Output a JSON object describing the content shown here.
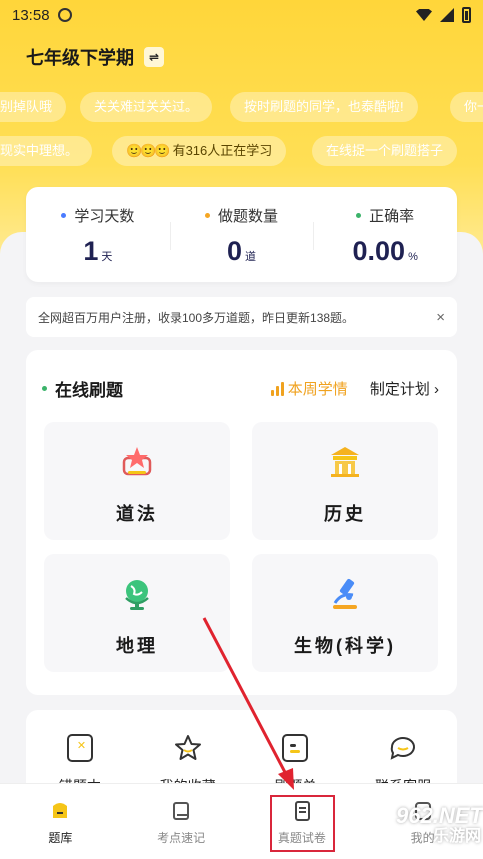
{
  "status": {
    "time": "13:58"
  },
  "header": {
    "grade": "七年级下学期",
    "switch_symbol": "⇌"
  },
  "ticker": {
    "row1": [
      "别掉队哦",
      "关关难过关关过。",
      "按时刷题的同学，也泰酷啦!",
      "你一"
    ],
    "row2": [
      "现实中理想。",
      "有316人正在学习",
      "在线捉一个刷题搭子"
    ]
  },
  "stats": [
    {
      "label": "学习天数",
      "value": "1",
      "unit": "天",
      "dot_color": "#4a7bff"
    },
    {
      "label": "做题数量",
      "value": "0",
      "unit": "道",
      "dot_color": "#f5a623"
    },
    {
      "label": "正确率",
      "value": "0.00",
      "unit": "%",
      "dot_color": "#3bb36a"
    }
  ],
  "notice": {
    "text": "全网超百万用户注册，收录100多万道题，昨日更新138题。",
    "close": "×"
  },
  "practice": {
    "title": "在线刷题",
    "weekly_label": "本周学情",
    "plan_label": "制定计划",
    "subjects": [
      {
        "label": "道法",
        "icon": "star-badge-icon"
      },
      {
        "label": "历史",
        "icon": "museum-icon"
      },
      {
        "label": "地理",
        "icon": "globe-icon"
      },
      {
        "label": "生物(科学)",
        "icon": "microscope-icon"
      }
    ]
  },
  "tools": [
    {
      "label": "错题本",
      "icon": "wrong-book-icon"
    },
    {
      "label": "我的收藏",
      "icon": "star-outline-icon"
    },
    {
      "label": "刷题单",
      "icon": "list-icon"
    },
    {
      "label": "联系客服",
      "icon": "chat-icon"
    }
  ],
  "tabs": [
    {
      "label": "题库",
      "icon": "question-bank-icon"
    },
    {
      "label": "考点速记",
      "icon": "notebook-icon"
    },
    {
      "label": "真题试卷",
      "icon": "paper-icon"
    },
    {
      "label": "我的",
      "icon": "profile-icon"
    }
  ],
  "watermark": {
    "top": "962.NET",
    "bottom": "乐游网"
  }
}
